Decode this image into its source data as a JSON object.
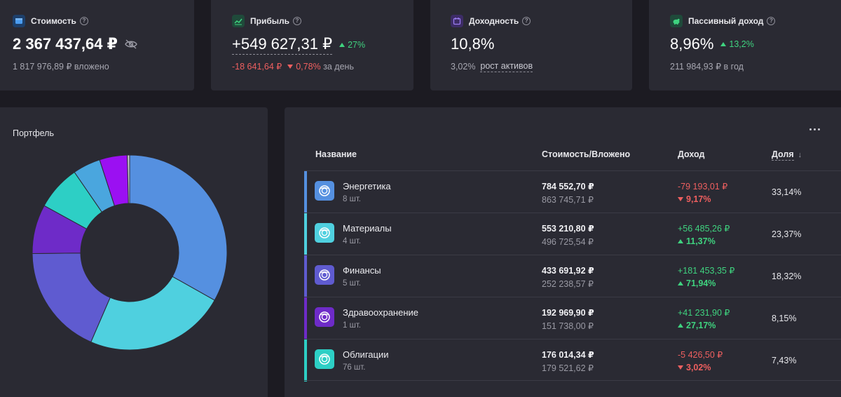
{
  "colors": {
    "background": "#1c1b22",
    "card": "#2a2a33",
    "up": "#3fd37f",
    "down": "#ee5f5f",
    "energy": "#5590e0",
    "materials": "#4fd0df",
    "finance": "#5f5bd0",
    "health": "#6e2bc8",
    "bonds": "#2dcfc5",
    "segment6": "#4aa6de",
    "segment7": "#9b10f2"
  },
  "stats": {
    "value": {
      "icon": "wallet-icon",
      "title": "Стоимость",
      "amount": "2 367 437,64 ₽",
      "sub_amount": "1 817 976,89 ₽",
      "sub_label": "вложено"
    },
    "profit": {
      "icon": "chart-line-icon",
      "title": "Прибыль",
      "amount": "+549 627,31 ₽",
      "badge": "27%",
      "day_amount": "-18 641,64 ₽",
      "day_percent": "0,78%",
      "day_label": "за день"
    },
    "yield": {
      "icon": "calendar-icon",
      "title": "Доходность",
      "amount": "10,8%",
      "sub_amount": "3,02%",
      "sub_label": "рост активов"
    },
    "passive": {
      "icon": "piggy-bank-icon",
      "title": "Пассивный доход",
      "amount": "8,96%",
      "badge": "13,2%",
      "sub_amount": "211 984,93 ₽",
      "sub_label": "в год"
    }
  },
  "portfolio": {
    "title": "Портфель",
    "segments": [
      {
        "value": 33.14,
        "color": "#5590e0"
      },
      {
        "value": 23.37,
        "color": "#4fd0df"
      },
      {
        "value": 18.32,
        "color": "#5f5bd0"
      },
      {
        "value": 8.15,
        "color": "#6e2bc8"
      },
      {
        "value": 7.43,
        "color": "#2dcfc5"
      },
      {
        "value": 4.6,
        "color": "#4aa6de"
      },
      {
        "value": 4.6,
        "color": "#9b10f2"
      },
      {
        "value": 0.39,
        "color": "#c8c8d0"
      }
    ]
  },
  "table": {
    "headers": {
      "name": "Название",
      "value": "Стоимость/Вложено",
      "income": "Доход",
      "share": "Доля"
    },
    "rows": [
      {
        "name": "Энергетика",
        "count": "8 шт.",
        "value": "784 552,70 ₽",
        "invested": "863 745,71 ₽",
        "income": "-79 193,01 ₽",
        "income_pct": "9,17%",
        "direction": "down",
        "share": "33,14%",
        "color": "#5590e0"
      },
      {
        "name": "Материалы",
        "count": "4 шт.",
        "value": "553 210,80 ₽",
        "invested": "496 725,54 ₽",
        "income": "+56 485,26 ₽",
        "income_pct": "11,37%",
        "direction": "up",
        "share": "23,37%",
        "color": "#4fd0df"
      },
      {
        "name": "Финансы",
        "count": "5 шт.",
        "value": "433 691,92 ₽",
        "invested": "252 238,57 ₽",
        "income": "+181 453,35 ₽",
        "income_pct": "71,94%",
        "direction": "up",
        "share": "18,32%",
        "color": "#5f5bd0"
      },
      {
        "name": "Здравоохранение",
        "count": "1 шт.",
        "value": "192 969,90 ₽",
        "invested": "151 738,00 ₽",
        "income": "+41 231,90 ₽",
        "income_pct": "27,17%",
        "direction": "up",
        "share": "8,15%",
        "color": "#6e2bc8"
      },
      {
        "name": "Облигации",
        "count": "76 шт.",
        "value": "176 014,34 ₽",
        "invested": "179 521,62 ₽",
        "income": "-5 426,50 ₽",
        "income_pct": "3,02%",
        "direction": "down",
        "share": "7,43%",
        "color": "#2dcfc5"
      }
    ]
  }
}
